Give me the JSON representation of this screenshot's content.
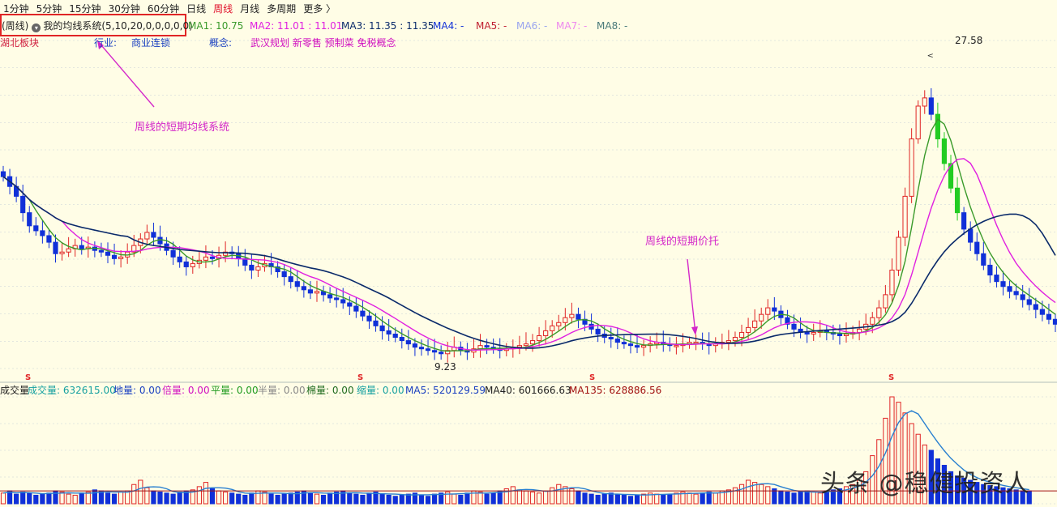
{
  "toolbar": {
    "lead": "",
    "items": [
      "1分钟",
      "5分钟",
      "15分钟",
      "30分钟",
      "60分钟",
      "日线",
      "周线",
      "月线",
      "多周期",
      "更多 〉"
    ],
    "active_index": 6
  },
  "info": {
    "period_label": "(周线)",
    "system_label": "我的均线系统(5,10,20,0,0,0,0,0)",
    "ma1": "MA1: 10.75",
    "ma2": "MA2: 11.01 : 11.01",
    "ma3": "MA3: 11.35 : 11.35",
    "ma4": "MA4: -",
    "ma5": "MA5: -",
    "ma6": "MA6: -",
    "ma7": "MA7: -",
    "ma8": "MA8: -"
  },
  "tags": {
    "region": "湖北板块",
    "industry_label": "行业:",
    "industry": "商业连锁",
    "concept_label": "概念:",
    "concepts": "武汉规划 新零售 预制菜 免税概念"
  },
  "annotations": {
    "ma_system": "周线的短期均线系统",
    "support": "周线的短期价托"
  },
  "price_labels": {
    "high": "27.58",
    "low": "9.23"
  },
  "volume": {
    "title": "成交量",
    "vol": "成交量: 632615.00",
    "di": "地量: 0.00",
    "bei": "倍量: 0.00",
    "ping": "平量: 0.00",
    "ban": "半量: 0.00",
    "mian": "棉量: 0.00",
    "suo": "缩量: 0.00",
    "ma5": "MA5: 520129.59",
    "ma40": "MA40: 601666.63",
    "ma135": "MA135: 628886.56"
  },
  "watermark": "头条 @稳健投资人",
  "colors": {
    "up": "#e02525",
    "down": "#1030d8",
    "flat_green": "#22cc22",
    "ma5": "#3a9a2a",
    "ma10": "#e020e0",
    "ma20": "#0a2a6a",
    "annotation": "#d427c9"
  },
  "chart_data": {
    "type": "candlestick",
    "price_ylim": [
      8.5,
      28.5
    ],
    "price_high": 27.58,
    "price_low": 9.23,
    "ma_lines": [
      {
        "name": "MA1",
        "period": 5
      },
      {
        "name": "MA2",
        "period": 10
      },
      {
        "name": "MA3",
        "period": 20
      }
    ],
    "closes": [
      20.2,
      19.6,
      19.0,
      18.0,
      17.2,
      16.9,
      16.6,
      16.2,
      15.5,
      15.6,
      15.8,
      16.0,
      15.8,
      15.9,
      15.7,
      15.6,
      15.4,
      15.2,
      15.3,
      15.6,
      16.0,
      16.4,
      16.8,
      16.5,
      16.1,
      15.7,
      15.3,
      15.0,
      14.7,
      14.9,
      15.1,
      15.3,
      15.2,
      15.4,
      15.6,
      15.5,
      15.2,
      14.8,
      14.5,
      14.7,
      14.9,
      14.7,
      14.4,
      14.1,
      13.8,
      13.5,
      13.3,
      13.1,
      13.2,
      13.0,
      12.8,
      12.7,
      12.5,
      12.3,
      12.0,
      11.7,
      11.4,
      11.1,
      10.8,
      10.6,
      10.4,
      10.2,
      10.0,
      9.8,
      9.7,
      9.6,
      9.5,
      9.4,
      9.6,
      9.8,
      9.6,
      9.5,
      9.7,
      9.9,
      9.8,
      9.7,
      9.6,
      9.7,
      9.8,
      9.9,
      10.0,
      10.2,
      10.5,
      10.8,
      11.1,
      11.3,
      11.6,
      11.8,
      11.5,
      11.2,
      10.9,
      10.6,
      10.4,
      10.3,
      10.1,
      10.0,
      9.9,
      9.8,
      9.9,
      10.0,
      10.1,
      10.0,
      9.9,
      9.9,
      10.0,
      10.1,
      10.1,
      10.0,
      9.9,
      10.0,
      10.1,
      10.2,
      10.4,
      10.7,
      11.0,
      11.4,
      11.8,
      12.2,
      12.0,
      11.6,
      11.2,
      10.9,
      10.7,
      10.6,
      10.7,
      10.8,
      10.7,
      10.6,
      10.5,
      10.6,
      10.7,
      10.9,
      11.2,
      11.6,
      12.2,
      13.0,
      14.5,
      16.5,
      19.0,
      22.5,
      24.5,
      25.0,
      24.0,
      22.5,
      21.0,
      19.5,
      18.0,
      17.0,
      16.2,
      15.5,
      14.8,
      14.2,
      13.8,
      13.5,
      13.2,
      13.0,
      12.7,
      12.4,
      12.1,
      11.8,
      11.5,
      11.2
    ],
    "volumes": [
      0.1,
      0.12,
      0.09,
      0.11,
      0.1,
      0.08,
      0.09,
      0.1,
      0.12,
      0.11,
      0.09,
      0.08,
      0.1,
      0.11,
      0.13,
      0.12,
      0.1,
      0.09,
      0.11,
      0.12,
      0.18,
      0.22,
      0.15,
      0.12,
      0.11,
      0.1,
      0.09,
      0.11,
      0.12,
      0.13,
      0.16,
      0.2,
      0.14,
      0.12,
      0.11,
      0.1,
      0.09,
      0.08,
      0.1,
      0.12,
      0.11,
      0.09,
      0.08,
      0.09,
      0.1,
      0.11,
      0.12,
      0.1,
      0.09,
      0.08,
      0.1,
      0.11,
      0.12,
      0.1,
      0.09,
      0.08,
      0.1,
      0.11,
      0.09,
      0.08,
      0.07,
      0.08,
      0.09,
      0.1,
      0.08,
      0.07,
      0.09,
      0.1,
      0.11,
      0.09,
      0.08,
      0.1,
      0.12,
      0.11,
      0.09,
      0.1,
      0.12,
      0.14,
      0.16,
      0.13,
      0.12,
      0.11,
      0.1,
      0.12,
      0.15,
      0.18,
      0.16,
      0.14,
      0.12,
      0.1,
      0.09,
      0.08,
      0.09,
      0.1,
      0.09,
      0.08,
      0.07,
      0.08,
      0.09,
      0.1,
      0.09,
      0.08,
      0.09,
      0.1,
      0.11,
      0.1,
      0.09,
      0.1,
      0.11,
      0.1,
      0.12,
      0.13,
      0.15,
      0.18,
      0.22,
      0.2,
      0.18,
      0.16,
      0.14,
      0.12,
      0.11,
      0.1,
      0.11,
      0.12,
      0.11,
      0.1,
      0.12,
      0.13,
      0.14,
      0.16,
      0.18,
      0.22,
      0.3,
      0.45,
      0.6,
      0.8,
      1.0,
      0.95,
      0.85,
      0.75,
      0.65,
      0.55,
      0.5,
      0.42,
      0.36,
      0.3,
      0.26,
      0.24,
      0.22,
      0.2,
      0.18,
      0.17,
      0.16,
      0.15,
      0.14,
      0.13,
      0.12,
      0.12
    ]
  }
}
